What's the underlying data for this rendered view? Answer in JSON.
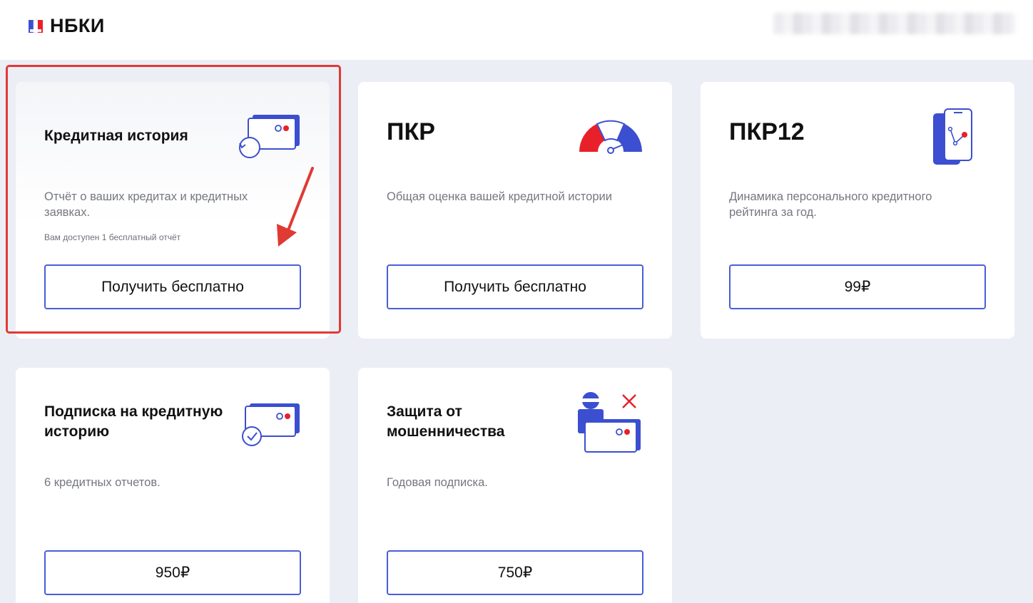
{
  "header": {
    "logo_text": "НБКИ",
    "logo_icon": "nbki-logo-icon"
  },
  "cards": [
    {
      "title": "Кредитная история",
      "description": "Отчёт о ваших кредитах и кредитных заявках.",
      "note": "Вам доступен 1 бесплатный отчёт",
      "button": "Получить бесплатно",
      "icon": "credit-card-history-icon"
    },
    {
      "title": "ПКР",
      "description": "Общая оценка вашей кредитной истории",
      "button": "Получить бесплатно",
      "icon": "rating-gauge-icon"
    },
    {
      "title": "ПКР12",
      "description": "Динамика персонального кредитного рейтинга за год.",
      "button": "99₽",
      "icon": "phone-chart-icon"
    },
    {
      "title": "Подписка на кредитную историю",
      "description": "6 кредитных отчетов.",
      "button": "950₽",
      "icon": "credit-card-check-icon"
    },
    {
      "title": "Защита от мошенничества",
      "description": "Годовая подписка.",
      "button": "750₽",
      "icon": "fraud-protection-icon"
    }
  ],
  "annotation": {
    "highlight_color": "#e03a34",
    "arrow_icon": "red-arrow-icon"
  },
  "colors": {
    "accent_blue": "#4a5ed6",
    "accent_red": "#e8202a",
    "page_bg": "#eceef6"
  }
}
